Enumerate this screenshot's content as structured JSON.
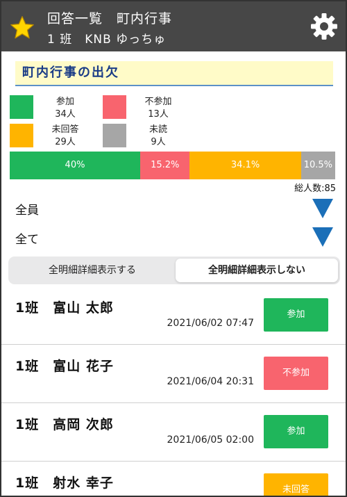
{
  "header": {
    "title": "回答一覧　町内行事",
    "subtitle": "1 班　KNB ゆっちゅ"
  },
  "section": {
    "title": "町内行事の出欠"
  },
  "legend": [
    {
      "label": "参加",
      "count": "34人",
      "color": "#1fb65b"
    },
    {
      "label": "不参加",
      "count": "13人",
      "color": "#f8646e"
    },
    {
      "label": "未回答",
      "count": "29人",
      "color": "#ffb400"
    },
    {
      "label": "未読",
      "count": "9人",
      "color": "#a6a6a6"
    }
  ],
  "summary_bar": {
    "segments": [
      {
        "label": "40%",
        "percent": 40.0,
        "color": "#1fb65b"
      },
      {
        "label": "15.2%",
        "percent": 15.2,
        "color": "#f8646e"
      },
      {
        "label": "34.1%",
        "percent": 34.1,
        "color": "#ffb400"
      },
      {
        "label": "10.5%",
        "percent": 10.5,
        "color": "#a6a6a6"
      }
    ],
    "total_label": "総人数:85"
  },
  "filters": {
    "member": "全員",
    "status": "全て",
    "arrow_color": "#1b6fb8"
  },
  "detail_toggle": {
    "show_label": "全明細詳細表示する",
    "hide_label": "全明細詳細表示しない",
    "selected": "hide"
  },
  "responses": [
    {
      "name": "1班　富山 太郎",
      "datetime": "2021/06/02 07:47",
      "status": "参加",
      "color": "#1fb65b"
    },
    {
      "name": "1班　富山 花子",
      "datetime": "2021/06/04 20:31",
      "status": "不参加",
      "color": "#f8646e"
    },
    {
      "name": "1班　高岡 次郎",
      "datetime": "2021/06/05 02:00",
      "status": "参加",
      "color": "#1fb65b"
    },
    {
      "name": "1班　射水 幸子",
      "datetime": "",
      "status": "未回答",
      "color": "#ffb400"
    }
  ],
  "icons": {
    "left": "star-icon",
    "right": "gear-icon"
  },
  "accent_colors": {
    "header_bg": "#474747",
    "star": "#ffd400",
    "section_bg": "#fffbc8",
    "section_text": "#173a86"
  }
}
